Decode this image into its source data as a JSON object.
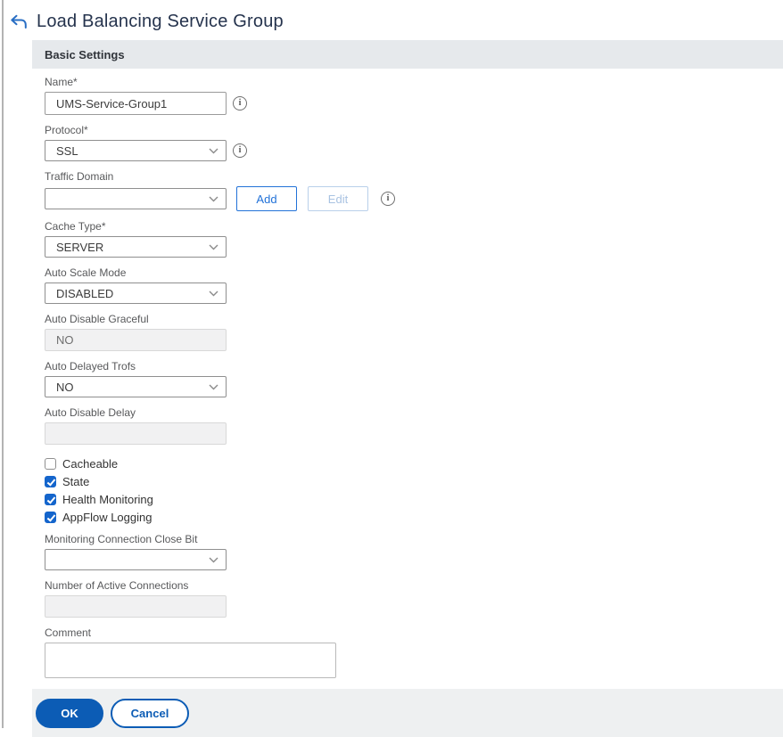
{
  "header": {
    "title": "Load Balancing Service Group"
  },
  "panel": {
    "title": "Basic Settings"
  },
  "fields": {
    "name": {
      "label": "Name*",
      "value": "UMS-Service-Group1"
    },
    "protocol": {
      "label": "Protocol*",
      "value": "SSL"
    },
    "traffic_domain": {
      "label": "Traffic Domain",
      "value": "",
      "add_label": "Add",
      "edit_label": "Edit"
    },
    "cache_type": {
      "label": "Cache Type*",
      "value": "SERVER"
    },
    "auto_scale_mode": {
      "label": "Auto Scale Mode",
      "value": "DISABLED"
    },
    "auto_disable_graceful": {
      "label": "Auto Disable Graceful",
      "value": "NO"
    },
    "auto_delayed_trofs": {
      "label": "Auto Delayed Trofs",
      "value": "NO"
    },
    "auto_disable_delay": {
      "label": "Auto Disable Delay",
      "value": ""
    },
    "monitoring_connection_close_bit": {
      "label": "Monitoring Connection Close Bit",
      "value": ""
    },
    "number_of_active_connections": {
      "label": "Number of Active Connections",
      "value": ""
    },
    "comment": {
      "label": "Comment",
      "value": ""
    }
  },
  "checkboxes": [
    {
      "label": "Cacheable",
      "checked": false
    },
    {
      "label": "State",
      "checked": true
    },
    {
      "label": "Health Monitoring",
      "checked": true
    },
    {
      "label": "AppFlow Logging",
      "checked": true
    }
  ],
  "actions": {
    "ok_label": "OK",
    "cancel_label": "Cancel"
  },
  "colors": {
    "brand_blue": "#0c5cb5",
    "checkbox_blue": "#1465cc",
    "panel_header_bg": "#e6e9ec",
    "panel_footer_bg": "#eef0f1",
    "disabled_bg": "#f1f1f2",
    "title_color": "#25334d"
  }
}
